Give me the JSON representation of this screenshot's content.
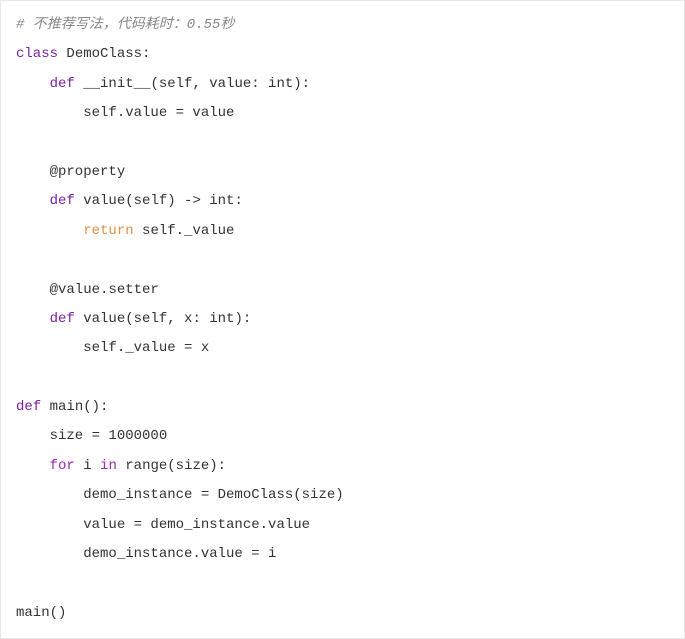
{
  "code": {
    "comment": "# 不推荐写法，代码耗时：0.55秒",
    "line1_kw": "class",
    "line1_rest": " DemoClass:",
    "line2_kw": "def",
    "line2_rest": " __init__(self, value: int):",
    "line3": "        self.value = value",
    "blank1": "",
    "line4": "    @property",
    "line5_kw": "def",
    "line5_rest": " value(self) -> int:",
    "line6_kw": "return",
    "line6_rest": " self._value",
    "blank2": "",
    "line7": "    @value.setter",
    "line8_kw": "def",
    "line8_rest": " value(self, x: int):",
    "line9": "        self._value = x",
    "blank3": "",
    "line10_kw": "def",
    "line10_rest": " main():",
    "line11": "    size = 1000000",
    "line12_for": "for",
    "line12_mid": " i ",
    "line12_in": "in",
    "line12_rest": " range(size):",
    "line13": "        demo_instance = DemoClass(size)",
    "line14": "        value = demo_instance.value",
    "line15": "        demo_instance.value = i",
    "blank4": "",
    "line16": "main()"
  }
}
